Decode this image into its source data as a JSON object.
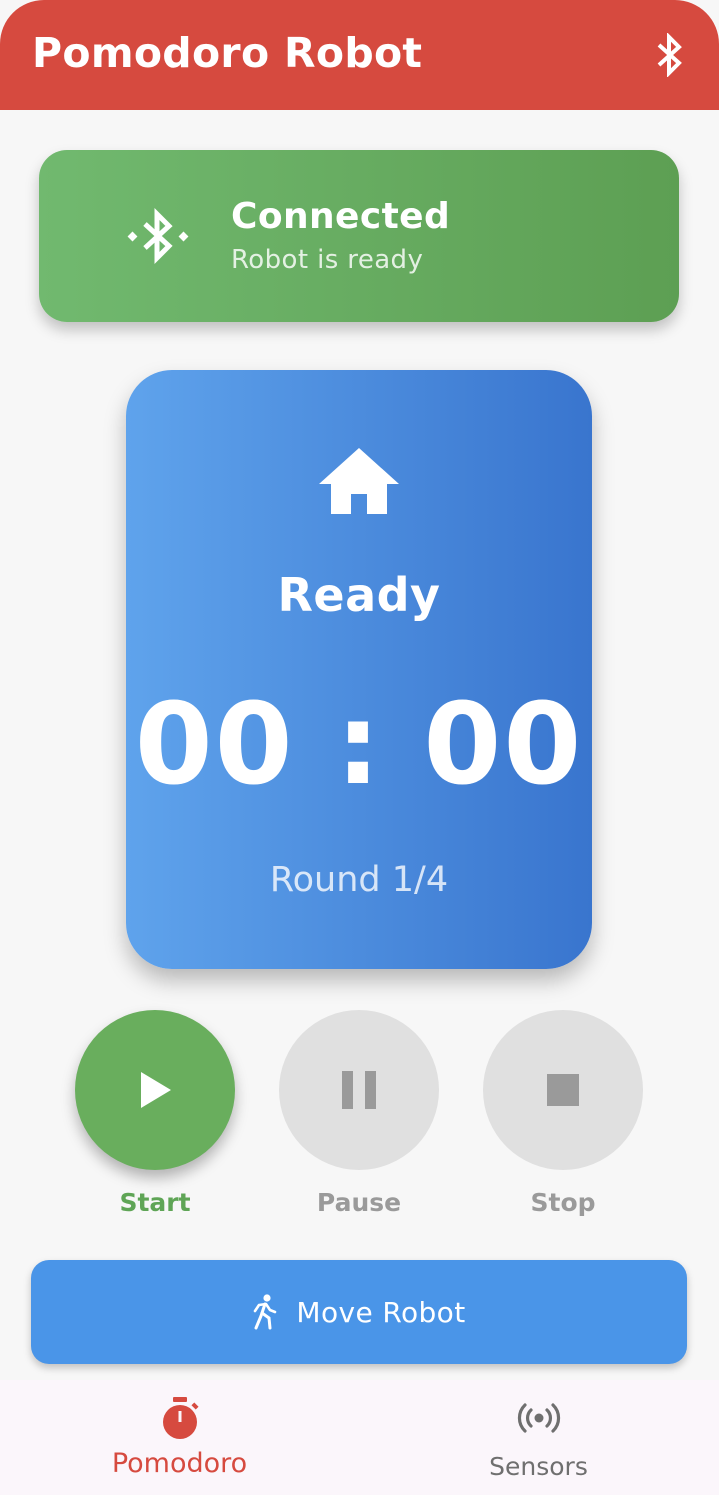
{
  "appbar": {
    "title": "Pomodoro Robot",
    "bluetooth_icon": "bluetooth-icon"
  },
  "connection": {
    "status": "Connected",
    "detail": "Robot is ready",
    "icon": "bluetooth-connected-icon",
    "color": "#6aae62"
  },
  "timer": {
    "icon": "home-icon",
    "state": "Ready",
    "time": "00 : 00",
    "round": "Round 1/4",
    "color": "#4a8ee0"
  },
  "controls": [
    {
      "label": "Start",
      "icon": "play-icon",
      "active": true
    },
    {
      "label": "Pause",
      "icon": "pause-icon",
      "active": false
    },
    {
      "label": "Stop",
      "icon": "stop-icon",
      "active": false
    }
  ],
  "move_button": {
    "label": "Move Robot",
    "icon": "walk-icon"
  },
  "bottom_nav": {
    "items": [
      {
        "label": "Pomodoro",
        "icon": "timer-icon",
        "active": true
      },
      {
        "label": "Sensors",
        "icon": "sensors-icon",
        "active": false
      }
    ]
  },
  "colors": {
    "primary": "#d64a3f",
    "connected": "#6aae62",
    "timer": "#4a8ee0",
    "action": "#4a95e8"
  }
}
